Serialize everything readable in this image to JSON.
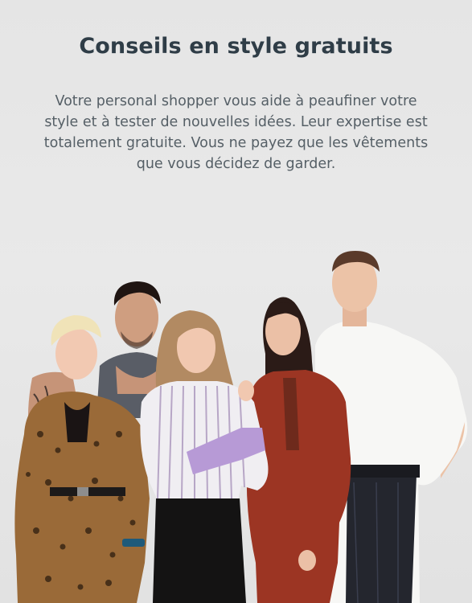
{
  "section": {
    "title": "Conseils en style gratuits",
    "description": "Votre personal shopper vous aide à peaufiner votre style et à tester de nouvelles idées. Leur expertise est totalement gratuite. Vous ne payez que les vêtements que vous décidez de garder."
  },
  "colors": {
    "background": "#e6e6e6",
    "title": "#2f3d47",
    "text": "#555f66"
  },
  "photo": {
    "subject": "team-photo"
  }
}
